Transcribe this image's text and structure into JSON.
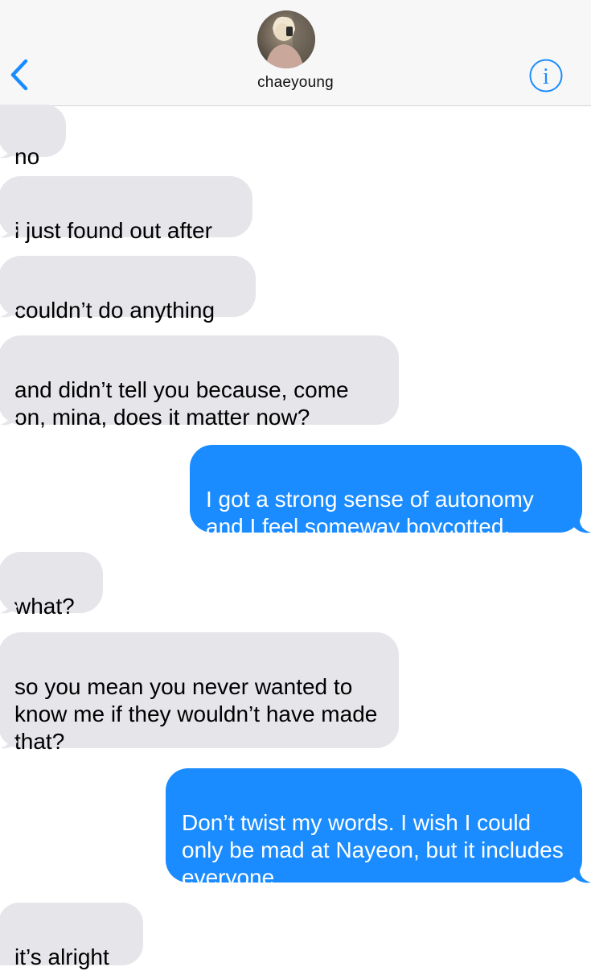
{
  "header": {
    "contact_name": "chaeyoung",
    "back_icon": "chevron-left-icon",
    "info_icon": "info-circle-icon",
    "accent_color": "#1a8cff"
  },
  "messages": [
    {
      "direction": "incoming",
      "text": "no"
    },
    {
      "direction": "incoming",
      "text": "i just found out after"
    },
    {
      "direction": "incoming",
      "text": "couldn’t do anything"
    },
    {
      "direction": "incoming",
      "text": "and didn’t tell you because, come on, mina, does it matter now?"
    },
    {
      "direction": "outgoing",
      "text": "I got a strong sense of autonomy and I feel someway boycotted."
    },
    {
      "direction": "incoming",
      "text": "what?"
    },
    {
      "direction": "incoming",
      "text": "so you mean you never wanted to know me if they wouldn’t have made that?"
    },
    {
      "direction": "outgoing",
      "text": "Don’t twist my words. I wish I could only be mad at Nayeon, but it includes everyone."
    },
    {
      "direction": "incoming",
      "text": "it’s alright"
    }
  ],
  "colors": {
    "incoming_bubble": "#e5e5ea",
    "outgoing_bubble": "#1a8cff"
  }
}
